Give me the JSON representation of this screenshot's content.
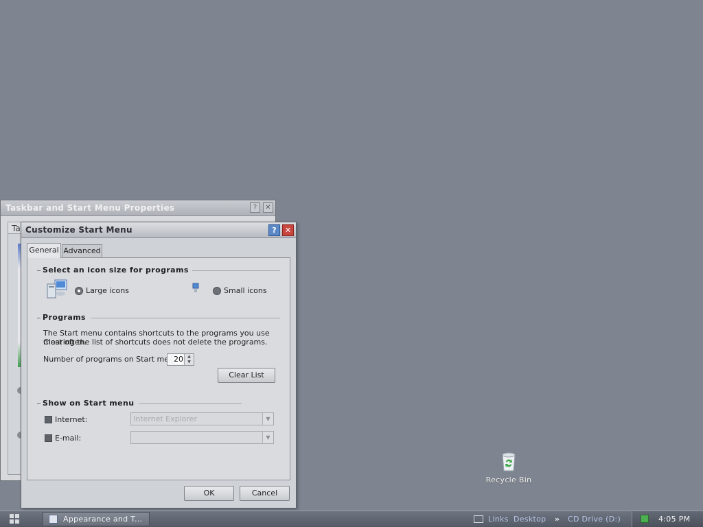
{
  "desktop": {
    "recycle_bin_label": "Recycle Bin"
  },
  "back_window": {
    "title": "Taskbar and Start Menu Properties",
    "tab_stub": "Ta"
  },
  "dialog": {
    "title": "Customize Start Menu",
    "tabs": [
      {
        "label": "General",
        "active": true
      },
      {
        "label": "Advanced",
        "active": false
      }
    ],
    "icon_size": {
      "heading": "Select an icon size for programs",
      "large_label": "Large icons",
      "small_label": "Small icons",
      "selected": "Large icons"
    },
    "programs": {
      "heading": "Programs",
      "description_line1": "The Start menu contains shortcuts to the programs you use most often.",
      "description_line2": "Clearing the list of shortcuts does not delete the programs.",
      "count_label": "Number of programs on Start menu:",
      "count_value": "20",
      "clear_button": "Clear List"
    },
    "show_on_start": {
      "heading": "Show on Start menu",
      "internet_label": "Internet:",
      "internet_value": "Internet Explorer",
      "email_label": "E-mail:",
      "email_value": ""
    },
    "ok_button": "OK",
    "cancel_button": "Cancel"
  },
  "taskbar": {
    "task_label": "Appearance and T...",
    "links_label": "Links",
    "desktop_label": "Desktop",
    "chevron": "»",
    "cd_drive_label": "CD Drive (D:)",
    "clock": "4:05 PM"
  }
}
